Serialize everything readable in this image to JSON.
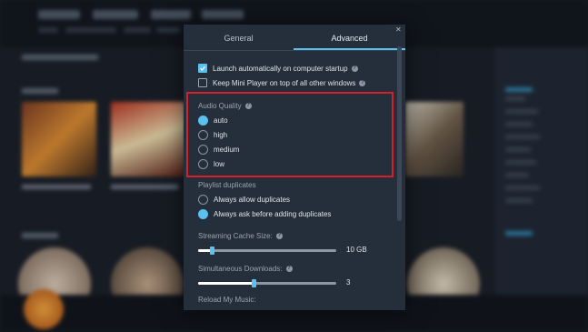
{
  "dialog": {
    "tabs": [
      {
        "label": "General",
        "active": false
      },
      {
        "label": "Advanced",
        "active": true
      }
    ],
    "close_icon": "close-icon",
    "checkboxes": [
      {
        "label": "Launch automatically on computer startup",
        "checked": true
      },
      {
        "label": "Keep Mini Player on top of all other windows",
        "checked": false
      }
    ],
    "audio_quality": {
      "label": "Audio Quality",
      "options": [
        "auto",
        "high",
        "medium",
        "low"
      ],
      "selected": "auto"
    },
    "playlist_duplicates": {
      "label": "Playlist duplicates",
      "options": [
        "Always allow duplicates",
        "Always ask before adding duplicates"
      ],
      "selected": "Always ask before adding duplicates"
    },
    "streaming_cache": {
      "label": "Streaming Cache Size:",
      "value_label": "10 GB",
      "fraction": 0.1
    },
    "simultaneous_downloads": {
      "label": "Simultaneous Downloads:",
      "value_label": "3",
      "fraction": 0.4
    },
    "reload_music": {
      "label": "Reload My Music:"
    }
  },
  "colors": {
    "accent": "#5bc1ef",
    "highlight": "#d6202b",
    "dialog_bg": "#252e3b"
  }
}
